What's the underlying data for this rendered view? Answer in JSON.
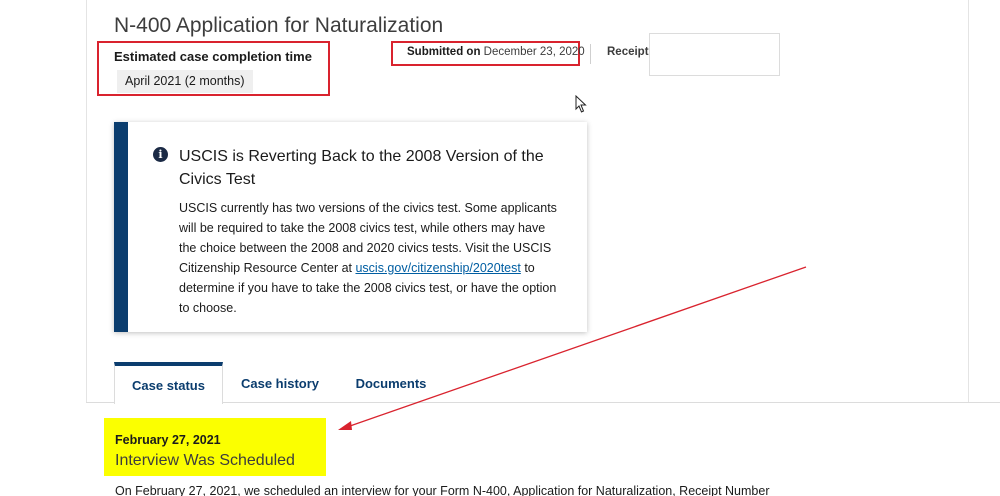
{
  "form": {
    "title": "N-400 Application for Naturalization"
  },
  "estimate": {
    "label": "Estimated case completion time",
    "value": "April 2021 (2 months)"
  },
  "submitted": {
    "label": "Submitted on",
    "date": "December 23, 2020"
  },
  "receipt": {
    "label": "Receipt"
  },
  "alert": {
    "title": "USCIS is Reverting Back to the 2008 Version of the Civics Test",
    "body_before": "USCIS currently has two versions of the civics test. Some applicants will be required to take the 2008 civics test, while others may have the choice between the 2008 and 2020 civics tests. Visit the USCIS Citizenship Resource Center at ",
    "link": "uscis.gov/citizenship/2020test",
    "body_after": " to determine if you have to take the 2008 civics test, or have the option to choose."
  },
  "tabs": [
    {
      "label": "Case status",
      "active": true
    },
    {
      "label": "Case history",
      "active": false
    },
    {
      "label": "Documents",
      "active": false
    }
  ],
  "event": {
    "date": "February 27, 2021",
    "title": "Interview Was Scheduled",
    "description": "On February 27, 2021, we scheduled an interview for your Form N-400, Application for Naturalization, Receipt Number"
  },
  "colors": {
    "annotation_red": "#d9232e",
    "highlight_yellow": "#fbff00",
    "navy": "#0b3d6e",
    "link_blue": "#005ea2"
  }
}
